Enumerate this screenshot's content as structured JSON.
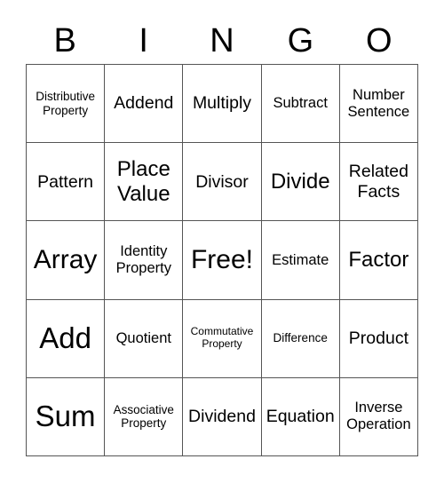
{
  "header": {
    "letters": [
      "B",
      "I",
      "N",
      "G",
      "O"
    ]
  },
  "board": {
    "cells": [
      [
        "Distributive Property",
        "Addend",
        "Multiply",
        "Subtract",
        "Number Sentence"
      ],
      [
        "Pattern",
        "Place Value",
        "Divisor",
        "Divide",
        "Related Facts"
      ],
      [
        "Array",
        "Identity Property",
        "Free!",
        "Estimate",
        "Factor"
      ],
      [
        "Add",
        "Quotient",
        "Commutative Property",
        "Difference",
        "Product"
      ],
      [
        "Sum",
        "Associative Property",
        "Dividend",
        "Equation",
        "Inverse Operation"
      ]
    ]
  }
}
